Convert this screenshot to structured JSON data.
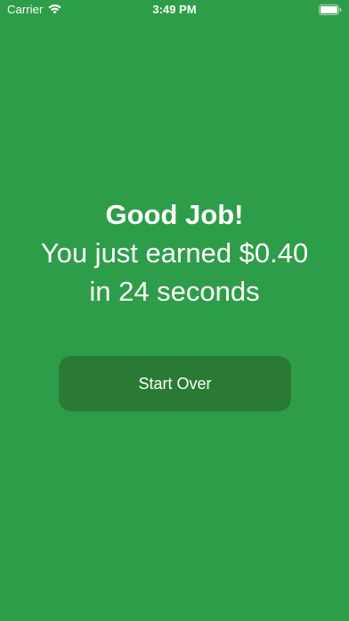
{
  "status_bar": {
    "carrier": "Carrier",
    "time": "3:49 PM",
    "icons": [
      "wifi-icon",
      "battery-icon"
    ]
  },
  "result": {
    "title": "Good Job!",
    "earned_line": "You just earned $0.40",
    "time_line": "in 24 seconds"
  },
  "actions": {
    "start_over_label": "Start Over"
  },
  "colors": {
    "background": "#2e9d49",
    "button": "#2a7a36",
    "text": "#ffffff"
  }
}
